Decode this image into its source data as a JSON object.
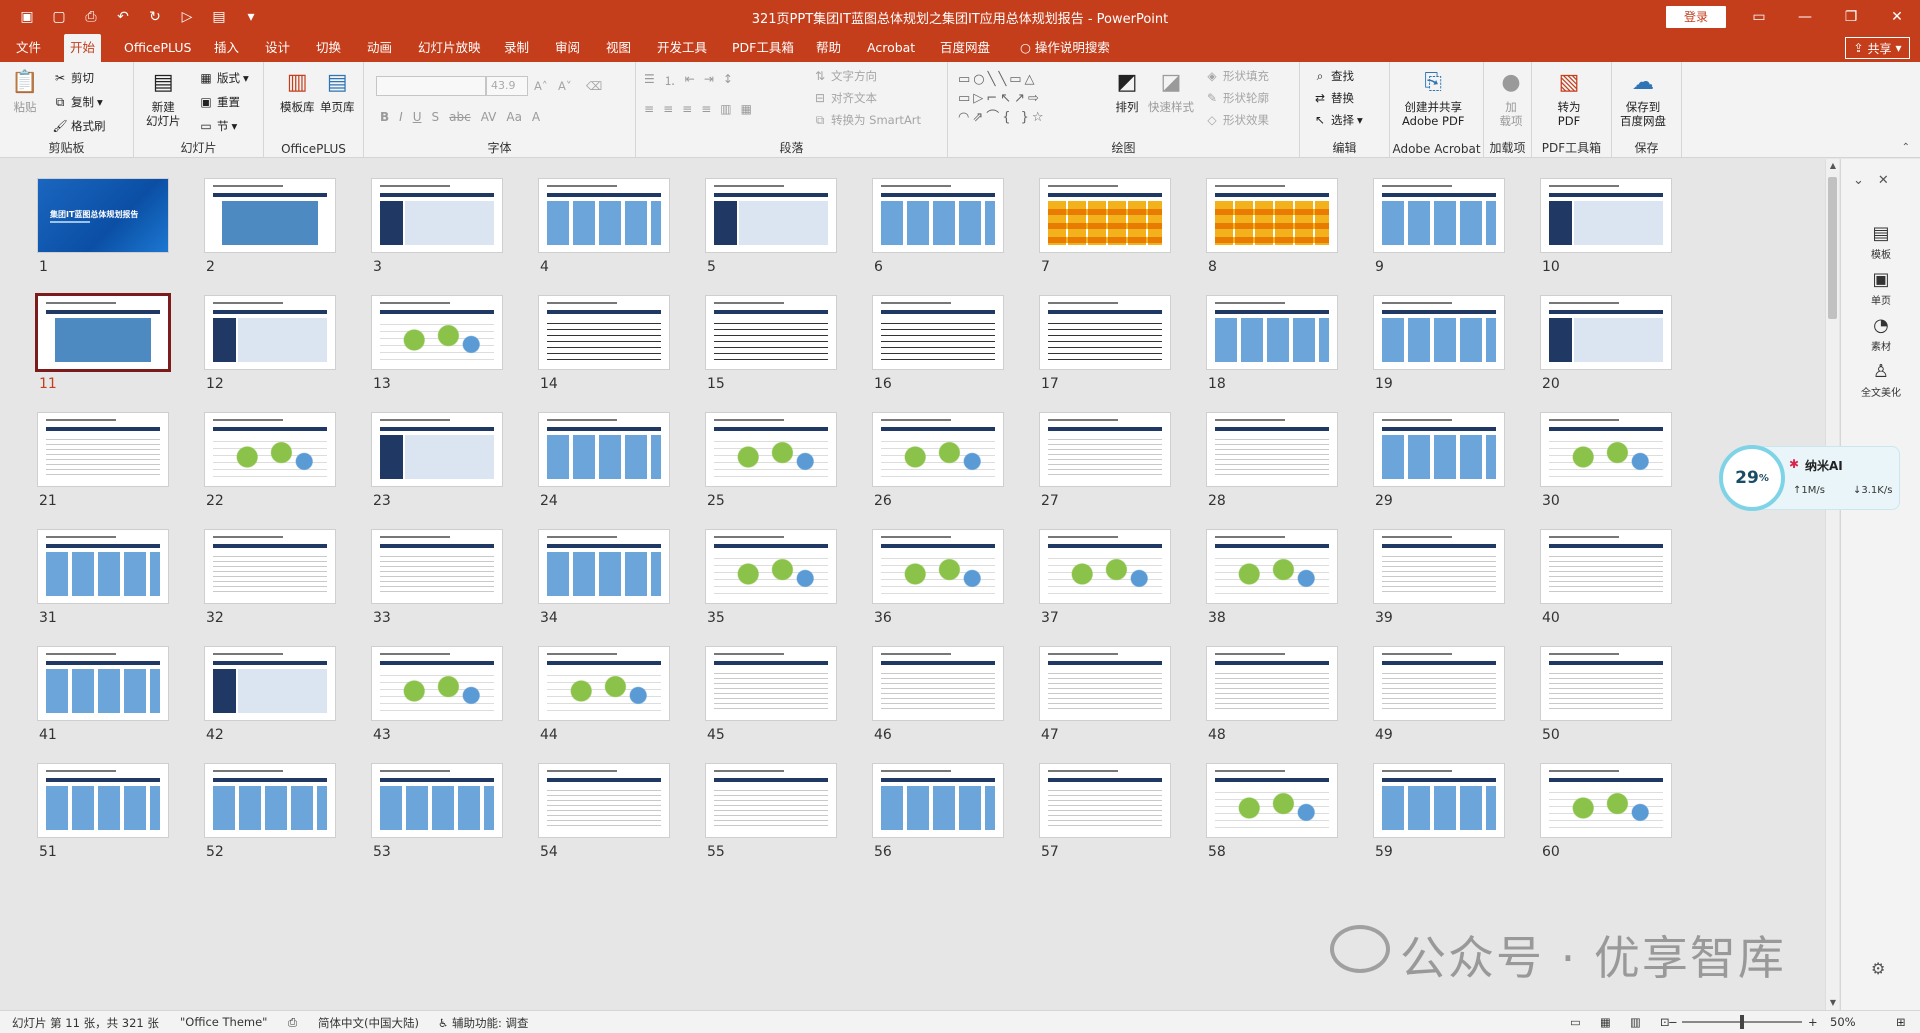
{
  "window": {
    "title": "321页PPT集团IT蓝图总体规划之集团IT应用总体规划报告  -  PowerPoint",
    "login_label": "登录"
  },
  "tabs": [
    "文件",
    "开始",
    "OfficePLUS",
    "插入",
    "设计",
    "切换",
    "动画",
    "幻灯片放映",
    "录制",
    "审阅",
    "视图",
    "开发工具",
    "PDF工具箱",
    "帮助",
    "Acrobat",
    "百度网盘",
    "操作说明搜索"
  ],
  "share_label": "共享",
  "ribbon": {
    "clipboard": {
      "label": "剪贴板",
      "paste": "粘贴",
      "cut": "剪切",
      "copy": "复制",
      "format": "格式刷"
    },
    "slides": {
      "label": "幻灯片",
      "new_slide": "新建\n幻灯片",
      "layout": "版式",
      "reset": "重置",
      "section": "节"
    },
    "officeplus": {
      "label": "OfficePLUS",
      "template": "模板库",
      "single_page": "单页库"
    },
    "font": {
      "label": "字体",
      "font_size": "43.9"
    },
    "paragraph": {
      "label": "段落",
      "text_direction": "文字方向",
      "align_text": "对齐文本",
      "smartart": "转换为 SmartArt"
    },
    "drawing": {
      "label": "绘图",
      "arrange": "排列",
      "quick_styles": "快速样式",
      "shape_fill": "形状填充",
      "shape_outline": "形状轮廓",
      "shape_effects": "形状效果"
    },
    "editing": {
      "label": "编辑",
      "find": "查找",
      "replace": "替换",
      "select": "选择"
    },
    "acrobat": {
      "label": "Adobe Acrobat",
      "create": "创建并共享\nAdobe PDF"
    },
    "addins": {
      "label": "加载项",
      "btn": "加\n载项"
    },
    "pdf_tools": {
      "label": "PDF工具箱",
      "btn": "转为\nPDF"
    },
    "save": {
      "label": "保存",
      "btn": "保存到\n百度网盘"
    }
  },
  "slides": {
    "numbers": [
      "1",
      "2",
      "3",
      "4",
      "5",
      "6",
      "7",
      "8",
      "9",
      "10",
      "11",
      "12",
      "13",
      "14",
      "15",
      "16",
      "17",
      "18",
      "19",
      "20",
      "21",
      "22",
      "23",
      "24",
      "25",
      "26",
      "27",
      "28",
      "29",
      "30",
      "31",
      "32",
      "33",
      "34",
      "35",
      "36",
      "37",
      "38",
      "39",
      "40",
      "41",
      "42",
      "43",
      "44",
      "45",
      "46",
      "47",
      "48",
      "49",
      "50",
      "51",
      "52",
      "53",
      "54",
      "55",
      "56",
      "57",
      "58",
      "59",
      "60"
    ],
    "selected": "11",
    "cover_title": "集团IT蓝图总体规划报告"
  },
  "right_pane": {
    "items": [
      "模板",
      "单页",
      "素材",
      "全文美化"
    ]
  },
  "ai_widget": {
    "percent": "29",
    "percent_sign": "%",
    "name": "纳米AI",
    "upload": "↑1M/s",
    "download": "↓3.1K/s"
  },
  "watermark": "公众号 · 优享智库",
  "status": {
    "slide_info": "幻灯片 第 11 张，共 321 张",
    "theme": "\"Office Theme\"",
    "language": "简体中文(中国大陆)",
    "accessibility": "辅助功能: 调查",
    "zoom": "50%"
  },
  "colors": {
    "accent": "#c43e1c",
    "selected_outline": "#7b1b1b"
  }
}
